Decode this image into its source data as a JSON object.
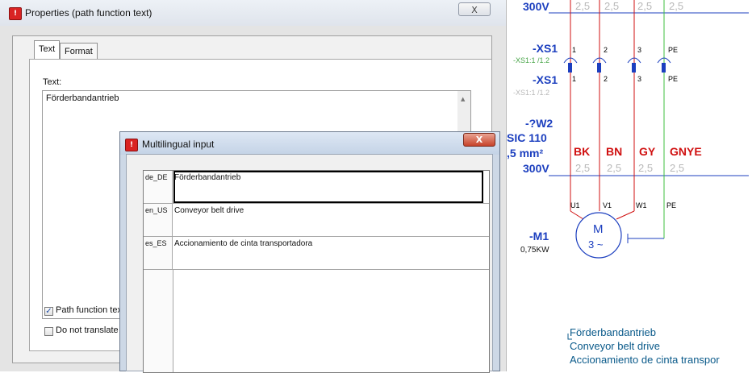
{
  "properties_window": {
    "title": "Properties (path function text)",
    "close_glyph": "X",
    "tabs": [
      "Text",
      "Format"
    ],
    "text_label": "Text:",
    "text_value": "Förderbandantrieb",
    "checkbox_path_function": "Path function text",
    "checkbox_path_function_checked": true,
    "checkbox_do_not_translate": "Do not translate au",
    "checkbox_do_not_translate_checked": false
  },
  "multilingual_dialog": {
    "title": "Multilingual input",
    "close_glyph": "X",
    "rows": [
      {
        "lang": "de_DE",
        "value": "Förderbandantrieb"
      },
      {
        "lang": "en_US",
        "value": "Conveyor belt drive"
      },
      {
        "lang": "es_ES",
        "value": "Accionamiento de cinta transportadora"
      }
    ]
  },
  "schematic": {
    "top_voltage": "300V",
    "top_ratings": [
      "2,5",
      "2,5",
      "2,5",
      "2,5"
    ],
    "connector_name": "-XS1",
    "connector_ref_1": "-XS1:1 /1.2",
    "connector_ref_2": "-XS1:1 /1.2",
    "connector_terminals": [
      "1",
      "2",
      "3",
      "PE"
    ],
    "cable_name": "-?W2",
    "cable_type": "SIC 110",
    "cable_section": ",5 mm²",
    "cable_voltage": "300V",
    "core_colors": [
      "BK",
      "BN",
      "GY",
      "GNYE"
    ],
    "core_sizes": [
      "2,5",
      "2,5",
      "2,5",
      "2,5"
    ],
    "motor_terminals": [
      "U1",
      "V1",
      "W1",
      "PE"
    ],
    "motor_name": "-M1",
    "motor_power": "0,75KW",
    "motor_symbol_top": "M",
    "motor_symbol_bottom": "3 ~",
    "multilingual_text": [
      "Förderbandantrieb",
      "Conveyor belt drive",
      "Accionamiento de cinta transpor"
    ],
    "wire_colors": {
      "phase": "#d01010",
      "pe": "#3fbf3f",
      "frame": "#1c3fbf"
    }
  }
}
